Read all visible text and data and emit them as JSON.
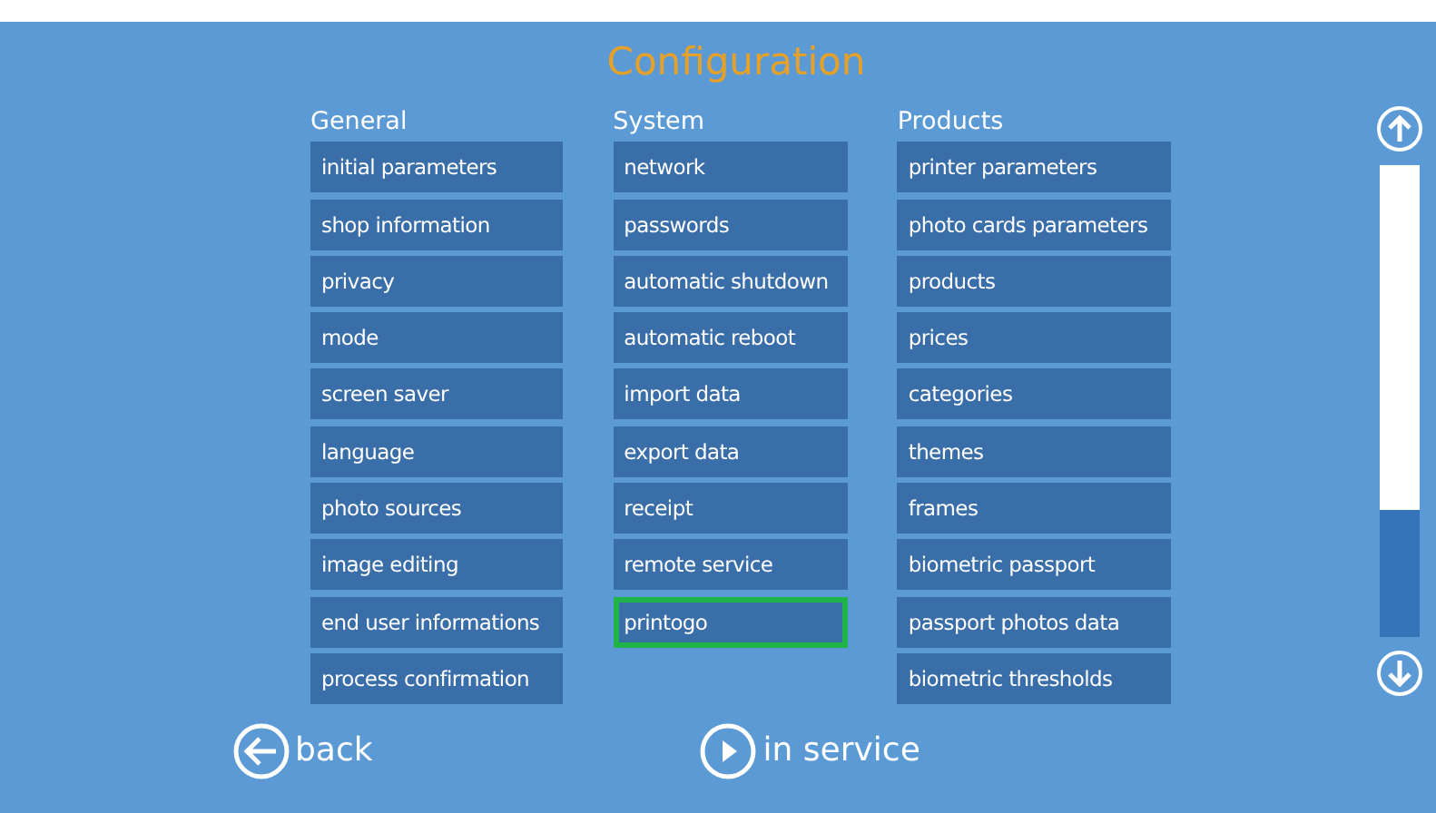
{
  "title": "Configuration",
  "columns": [
    {
      "heading": "General",
      "items": [
        {
          "label": "initial parameters",
          "selected": false
        },
        {
          "label": "shop information",
          "selected": false
        },
        {
          "label": "privacy",
          "selected": false
        },
        {
          "label": "mode",
          "selected": false
        },
        {
          "label": "screen saver",
          "selected": false
        },
        {
          "label": "language",
          "selected": false
        },
        {
          "label": "photo sources",
          "selected": false
        },
        {
          "label": "image editing",
          "selected": false
        },
        {
          "label": "end user informations",
          "selected": false
        },
        {
          "label": "process confirmation",
          "selected": false
        }
      ]
    },
    {
      "heading": "System",
      "items": [
        {
          "label": "network",
          "selected": false
        },
        {
          "label": "passwords",
          "selected": false
        },
        {
          "label": "automatic shutdown",
          "selected": false
        },
        {
          "label": "automatic reboot",
          "selected": false
        },
        {
          "label": "import data",
          "selected": false
        },
        {
          "label": "export data",
          "selected": false
        },
        {
          "label": "receipt",
          "selected": false
        },
        {
          "label": "remote service",
          "selected": false
        },
        {
          "label": "printogo",
          "selected": true
        }
      ]
    },
    {
      "heading": "Products",
      "items": [
        {
          "label": "printer parameters",
          "selected": false
        },
        {
          "label": "photo cards parameters",
          "selected": false
        },
        {
          "label": "products",
          "selected": false
        },
        {
          "label": "prices",
          "selected": false
        },
        {
          "label": "categories",
          "selected": false
        },
        {
          "label": "themes",
          "selected": false
        },
        {
          "label": "frames",
          "selected": false
        },
        {
          "label": "biometric passport",
          "selected": false
        },
        {
          "label": "passport photos data",
          "selected": false
        },
        {
          "label": "biometric thresholds",
          "selected": false
        }
      ]
    }
  ],
  "footer": {
    "back": "back",
    "in_service": "in service"
  }
}
